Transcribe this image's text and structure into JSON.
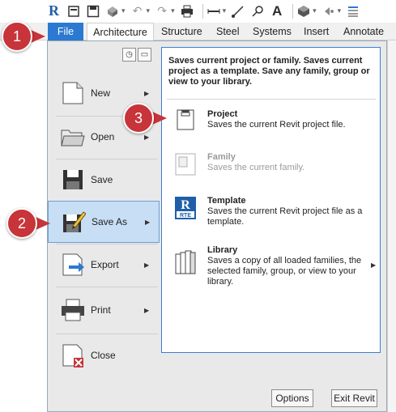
{
  "quick_access": {
    "icons": [
      "revit-logo",
      "open-icon",
      "save-icon",
      "sync-icon",
      "undo-icon",
      "redo-icon",
      "print-icon",
      "measure-icon",
      "dimension-icon",
      "tag-icon",
      "text-icon",
      "3d-view-icon",
      "section-icon",
      "thin-lines-icon"
    ]
  },
  "tabs": {
    "file": "File",
    "architecture": "Architecture",
    "structure": "Structure",
    "steel": "Steel",
    "systems": "Systems",
    "insert": "Insert",
    "annotate": "Annotate"
  },
  "menu": {
    "items": [
      {
        "label": "New",
        "icon": "new-document-icon",
        "has_submenu": true
      },
      {
        "label": "Open",
        "icon": "open-folder-icon",
        "has_submenu": true
      },
      {
        "label": "Save",
        "icon": "floppy-disk-icon",
        "has_submenu": false
      },
      {
        "label": "Save As",
        "icon": "save-as-icon",
        "has_submenu": true,
        "active": true
      },
      {
        "label": "Export",
        "icon": "export-icon",
        "has_submenu": true
      },
      {
        "label": "Print",
        "icon": "printer-icon",
        "has_submenu": true
      },
      {
        "label": "Close",
        "icon": "close-document-icon",
        "has_submenu": false
      }
    ]
  },
  "flyout": {
    "description": "Saves current project or family. Saves current project as a template. Save any family, group or view to your library.",
    "items": [
      {
        "title": "Project",
        "desc": "Saves the current Revit project file.",
        "icon": "project-icon",
        "enabled": true
      },
      {
        "title": "Family",
        "desc": "Saves the current family.",
        "icon": "family-icon",
        "enabled": false
      },
      {
        "title": "Template",
        "desc": "Saves the current Revit project file as a template.",
        "icon": "rte-template-icon",
        "badge": "RTE",
        "enabled": true
      },
      {
        "title": "Library",
        "desc": "Saves a copy of all loaded families, the selected family, group, or view to your library.",
        "icon": "library-icon",
        "enabled": true,
        "has_submenu": true
      }
    ]
  },
  "buttons": {
    "options": "Options",
    "exit": "Exit Revit"
  },
  "callouts": [
    "1",
    "2",
    "3"
  ],
  "colors": {
    "file_tab": "#2b79d1",
    "callout": "#c7343a",
    "active_item": "#c7def5",
    "flyout_border": "#3a7fd0"
  }
}
